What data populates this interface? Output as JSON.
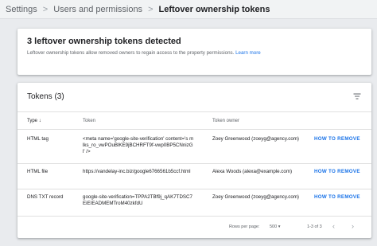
{
  "breadcrumb": {
    "items": [
      "Settings",
      "Users and permissions",
      "Leftover ownership tokens"
    ],
    "separator": ">"
  },
  "banner": {
    "title": "3 leftover ownership tokens detected",
    "description": "Leftover ownership tokens allow removed owners to regain access to the property permissions.",
    "link_label": "Learn more"
  },
  "tokens": {
    "title": "Tokens (3)",
    "columns": {
      "type": "Type",
      "token": "Token",
      "owner": "Token owner"
    },
    "rows": [
      {
        "type": "HTML tag",
        "token": "<meta name='google-site-verification' content='s mlks_ro_vwPOuBlKE9jBCHRFT9f-vwp0BP5CNnizGl' />",
        "owner": "Zoey Greenwood (zoeyg@agency.com)",
        "action": "HOW TO REMOVE"
      },
      {
        "type": "HTML file",
        "token": "https://vandelay-inc.biz/google6766561b5ccf.html",
        "owner": "Alexa Woods (alexa@example.com)",
        "action": "HOW TO REMOVE"
      },
      {
        "type": "DNS TXT record",
        "token": "google-site-verification=TPPA2TBf9j_qAK7TDSC7EiEIEADMEMTroM40zkfdU",
        "owner": "Zoey Greenwood (zoeyg@agency.com)",
        "action": "HOW TO REMOVE"
      }
    ],
    "footer": {
      "rows_per_page_label": "Rows per page:",
      "rows_per_page_value": "500",
      "range": "1-3 of 3"
    }
  },
  "colors": {
    "accent": "#1a73e8",
    "background": "#e9ebee",
    "card": "#ffffff"
  },
  "icons": [
    "chevron-right-icon",
    "filter-icon",
    "arrow-down-icon",
    "chevron-left-icon",
    "chevron-right-icon",
    "dropdown-icon"
  ]
}
